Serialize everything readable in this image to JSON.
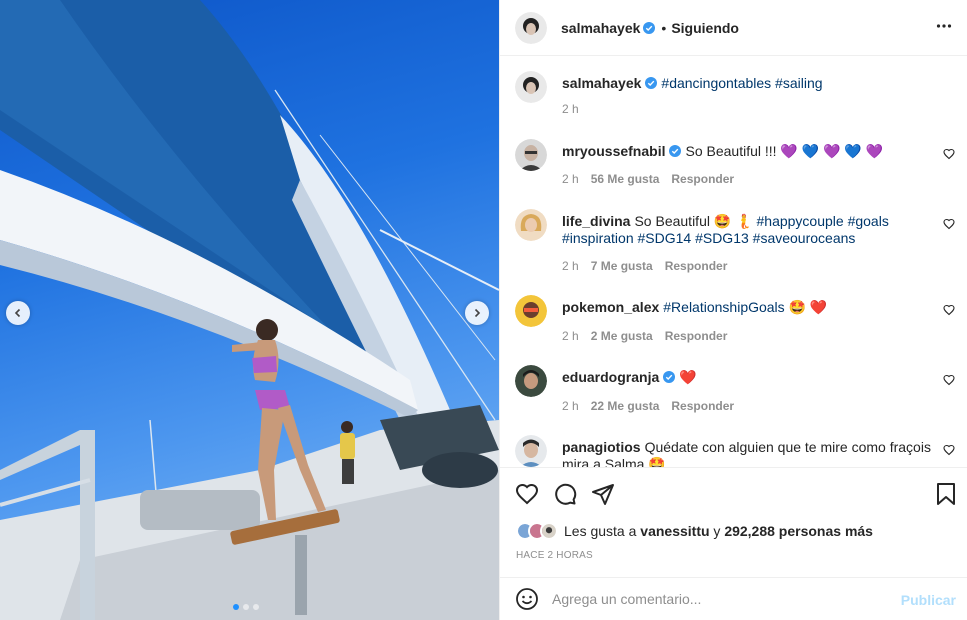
{
  "post": {
    "author": "salmahayek",
    "follow_status": "Siguiendo",
    "separator": "•",
    "caption_hashtags": "#dancingontables #sailing",
    "caption_time": "2 h"
  },
  "comments": [
    {
      "user": "mryoussefnabil",
      "text": "So Beautiful !!! 💜 💙 💜 💙 💜",
      "time": "2 h",
      "likes": "56 Me gusta",
      "reply": "Responder"
    },
    {
      "user": "life_divina",
      "text": "So Beautiful 🤩 🧜",
      "tags": "#happycouple #goals #inspiration #SDG14 #SDG13 #saveouroceans",
      "time": "2 h",
      "likes": "7 Me gusta",
      "reply": "Responder"
    },
    {
      "user": "pokemon_alex",
      "tags": "#RelationshipGoals",
      "text_after": "🤩 ❤️",
      "time": "2 h",
      "likes": "2 Me gusta",
      "reply": "Responder"
    },
    {
      "user": "eduardogranja",
      "text": "❤️",
      "time": "2 h",
      "likes": "22 Me gusta",
      "reply": "Responder"
    },
    {
      "user": "panagiotios",
      "text": "Quédate con alguien que te mire como fraçois mira a Salma 🤩"
    }
  ],
  "likes": {
    "prefix": "Les gusta a",
    "user": "vanessittu",
    "middle": "y",
    "count": "292,288 personas más"
  },
  "timestamp": "HACE 2 HORAS",
  "add_comment": {
    "placeholder": "Agrega un comentario...",
    "publish_label": "Publicar"
  },
  "icons": {
    "verified": "verified-badge-icon",
    "more": "more-options-icon",
    "like": "heart-icon",
    "comment": "comment-icon",
    "share": "share-icon",
    "save": "bookmark-icon",
    "emoji": "emoji-icon",
    "prev": "chevron-left-icon",
    "next": "chevron-right-icon"
  },
  "colors": {
    "verified": "#3897f0",
    "hashtag": "#00376b",
    "muted": "#8e8e8e",
    "publish_disabled": "#b2dffc"
  }
}
